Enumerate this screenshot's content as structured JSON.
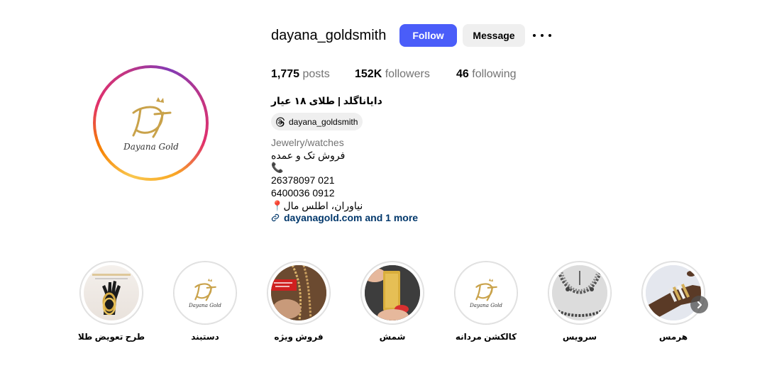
{
  "profile": {
    "username": "dayana_goldsmith",
    "follow_label": "Follow",
    "message_label": "Message",
    "posts_count": "1,775",
    "posts_label": "posts",
    "followers_count": "152K",
    "followers_label": "followers",
    "following_count": "46",
    "following_label": "following",
    "full_name": "دایاناگلد | طلای ۱۸ عیار",
    "threads_handle": "dayana_goldsmith",
    "category": "Jewelry/watches",
    "bio": [
      "فروش تک و عمده",
      "📞",
      "26378097 021",
      "6400036 0912",
      "📍نیاوران، اطلس مال"
    ],
    "link_text": "dayanagold.com and 1 more",
    "avatar_logo_text": "Dayana Gold"
  },
  "highlights": [
    {
      "label": "طرح تعویض طلا",
      "icon": "hand-bangles-image"
    },
    {
      "label": "دستبند",
      "icon": "dayana-gold-logo"
    },
    {
      "label": "فروش ویژه",
      "icon": "special-sale-image"
    },
    {
      "label": "شمش",
      "icon": "gold-bar-image"
    },
    {
      "label": "کالکشن مردانه",
      "icon": "dayana-gold-logo"
    },
    {
      "label": "سرویس",
      "icon": "jewelry-set-image"
    },
    {
      "label": "هرمس",
      "icon": "bracelet-wrist-image"
    }
  ],
  "colors": {
    "follow_button": "#4a5df9",
    "secondary_button": "#efefef",
    "link": "#00376b",
    "gold": "#c9a24a"
  },
  "icons": {
    "more": "more-options-icon",
    "threads": "threads-icon",
    "link": "link-icon",
    "next": "chevron-right-icon"
  }
}
